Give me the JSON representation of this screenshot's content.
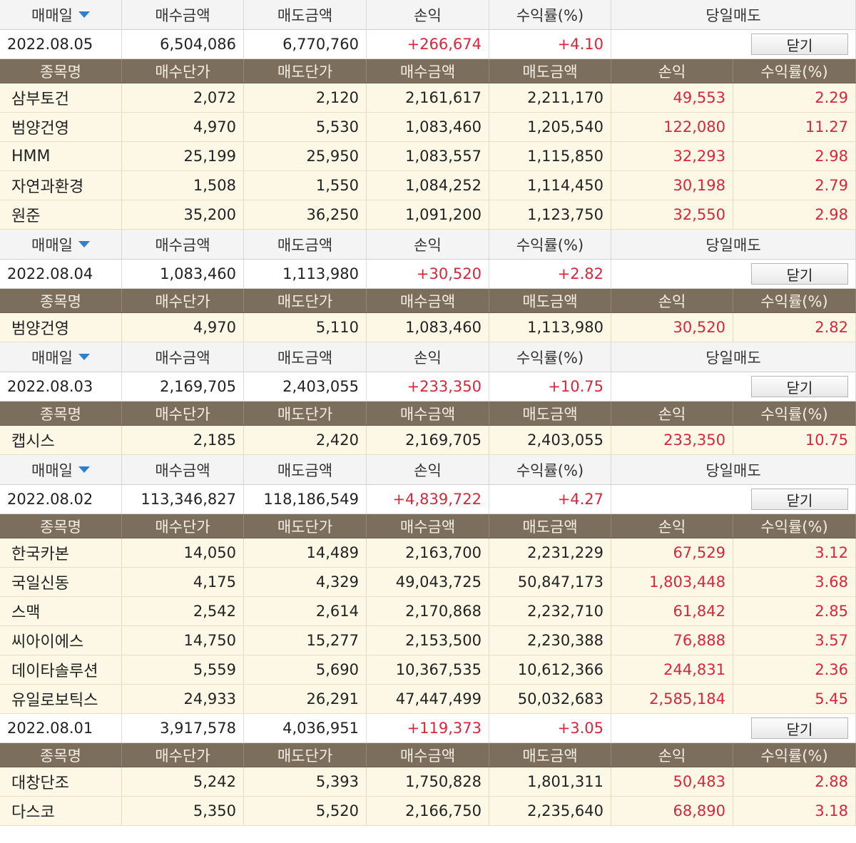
{
  "labels": {
    "trade_date": "매매일",
    "buy_amount": "매수금액",
    "sell_amount": "매도금액",
    "profit": "손익",
    "return_rate": "수익률(%)",
    "same_day_sell": "당일매도",
    "close": "닫기",
    "stock_name": "종목명",
    "buy_price": "매수단가",
    "sell_price": "매도단가"
  },
  "days": [
    {
      "date": "2022.08.05",
      "buy_amount": "6,504,086",
      "sell_amount": "6,770,760",
      "profit": "+266,674",
      "return_rate": "+4.10",
      "items": [
        {
          "name": "삼부토건",
          "buy_price": "2,072",
          "sell_price": "2,120",
          "buy_amount": "2,161,617",
          "sell_amount": "2,211,170",
          "profit": "49,553",
          "return_rate": "2.29"
        },
        {
          "name": "범양건영",
          "buy_price": "4,970",
          "sell_price": "5,530",
          "buy_amount": "1,083,460",
          "sell_amount": "1,205,540",
          "profit": "122,080",
          "return_rate": "11.27"
        },
        {
          "name": "HMM",
          "buy_price": "25,199",
          "sell_price": "25,950",
          "buy_amount": "1,083,557",
          "sell_amount": "1,115,850",
          "profit": "32,293",
          "return_rate": "2.98"
        },
        {
          "name": "자연과환경",
          "buy_price": "1,508",
          "sell_price": "1,550",
          "buy_amount": "1,084,252",
          "sell_amount": "1,114,450",
          "profit": "30,198",
          "return_rate": "2.79"
        },
        {
          "name": "원준",
          "buy_price": "35,200",
          "sell_price": "36,250",
          "buy_amount": "1,091,200",
          "sell_amount": "1,123,750",
          "profit": "32,550",
          "return_rate": "2.98"
        }
      ]
    },
    {
      "date": "2022.08.04",
      "buy_amount": "1,083,460",
      "sell_amount": "1,113,980",
      "profit": "+30,520",
      "return_rate": "+2.82",
      "items": [
        {
          "name": "범양건영",
          "buy_price": "4,970",
          "sell_price": "5,110",
          "buy_amount": "1,083,460",
          "sell_amount": "1,113,980",
          "profit": "30,520",
          "return_rate": "2.82"
        }
      ]
    },
    {
      "date": "2022.08.03",
      "buy_amount": "2,169,705",
      "sell_amount": "2,403,055",
      "profit": "+233,350",
      "return_rate": "+10.75",
      "items": [
        {
          "name": "캡시스",
          "buy_price": "2,185",
          "sell_price": "2,420",
          "buy_amount": "2,169,705",
          "sell_amount": "2,403,055",
          "profit": "233,350",
          "return_rate": "10.75"
        }
      ]
    },
    {
      "date": "2022.08.02",
      "buy_amount": "113,346,827",
      "sell_amount": "118,186,549",
      "profit": "+4,839,722",
      "return_rate": "+4.27",
      "items": [
        {
          "name": "한국카본",
          "buy_price": "14,050",
          "sell_price": "14,489",
          "buy_amount": "2,163,700",
          "sell_amount": "2,231,229",
          "profit": "67,529",
          "return_rate": "3.12"
        },
        {
          "name": "국일신동",
          "buy_price": "4,175",
          "sell_price": "4,329",
          "buy_amount": "49,043,725",
          "sell_amount": "50,847,173",
          "profit": "1,803,448",
          "return_rate": "3.68"
        },
        {
          "name": "스맥",
          "buy_price": "2,542",
          "sell_price": "2,614",
          "buy_amount": "2,170,868",
          "sell_amount": "2,232,710",
          "profit": "61,842",
          "return_rate": "2.85"
        },
        {
          "name": "씨아이에스",
          "buy_price": "14,750",
          "sell_price": "15,277",
          "buy_amount": "2,153,500",
          "sell_amount": "2,230,388",
          "profit": "76,888",
          "return_rate": "3.57"
        },
        {
          "name": "데이타솔루션",
          "buy_price": "5,559",
          "sell_price": "5,690",
          "buy_amount": "10,367,535",
          "sell_amount": "10,612,366",
          "profit": "244,831",
          "return_rate": "2.36"
        },
        {
          "name": "유일로보틱스",
          "buy_price": "24,933",
          "sell_price": "26,291",
          "buy_amount": "47,447,499",
          "sell_amount": "50,032,683",
          "profit": "2,585,184",
          "return_rate": "5.45"
        }
      ]
    },
    {
      "date": "2022.08.01",
      "buy_amount": "3,917,578",
      "sell_amount": "4,036,951",
      "profit": "+119,373",
      "return_rate": "+3.05",
      "items": [
        {
          "name": "대창단조",
          "buy_price": "5,242",
          "sell_price": "5,393",
          "buy_amount": "1,750,828",
          "sell_amount": "1,801,311",
          "profit": "50,483",
          "return_rate": "2.88"
        },
        {
          "name": "다스코",
          "buy_price": "5,350",
          "sell_price": "5,520",
          "buy_amount": "2,166,750",
          "sell_amount": "2,235,640",
          "profit": "68,890",
          "return_rate": "3.18"
        }
      ]
    }
  ],
  "colors": {
    "profit_red": "#d8263b",
    "detail_header_bg": "#7b6e5c",
    "item_row_bg": "#fdf8e6",
    "sort_arrow": "#2f7fd1"
  },
  "icons": {
    "sort": "chevron-down-icon"
  }
}
